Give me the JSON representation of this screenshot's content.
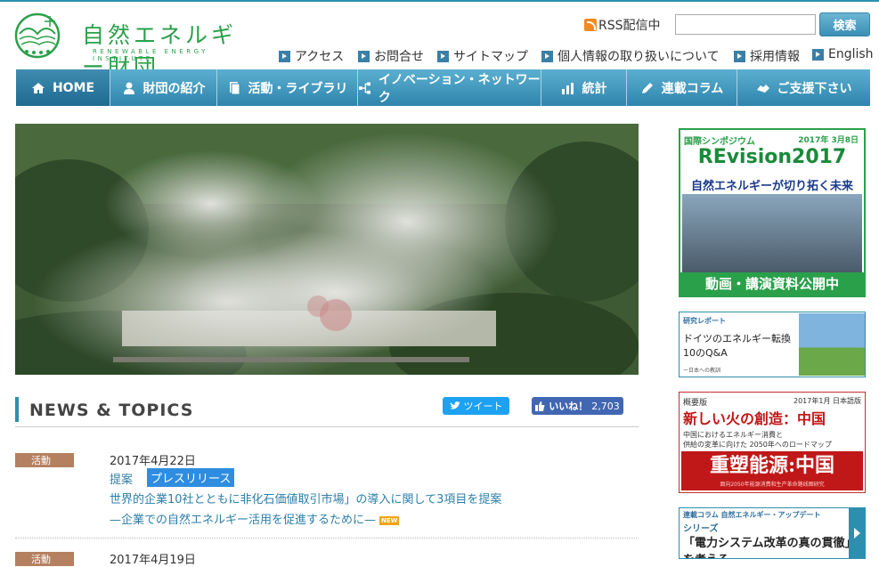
{
  "header": {
    "logo_jp": "自然エネルギー財団",
    "logo_en": "RENEWABLE ENERGY INSTITUTE",
    "rss_label": "RSS配信中",
    "search_placeholder": "",
    "search_button": "検索",
    "util_links": [
      "アクセス",
      "お問合せ",
      "サイトマップ",
      "個人情報の取り扱いについて",
      "採用情報",
      "English"
    ]
  },
  "nav": {
    "items": [
      {
        "label": "HOME",
        "icon": "home-icon"
      },
      {
        "label": "財団の紹介",
        "icon": "person-icon"
      },
      {
        "label": "活動・ライブラリ",
        "icon": "document-icon"
      },
      {
        "label": "イノベーション・ネットワーク",
        "icon": "network-icon"
      },
      {
        "label": "統計",
        "icon": "bar-chart-icon"
      },
      {
        "label": "連載コラム",
        "icon": "pen-icon"
      },
      {
        "label": "ご支援下さい",
        "icon": "handshake-icon"
      }
    ]
  },
  "news": {
    "title": "NEWS & TOPICS",
    "tweet_label": "ツイート",
    "fb_label": "いいね！",
    "fb_count": "2,703",
    "items": [
      {
        "tag": "活動",
        "date": "2017年4月22日",
        "category": "提案",
        "badge": "プレスリリース",
        "line1": "世界的企業10社とともに非化石価値取引市場」の導入に関して3項目を提案",
        "line2": "—企業での自然エネルギー活用を促進するために—",
        "new_label": "NEW"
      },
      {
        "tag": "活動",
        "date": "2017年4月19日"
      }
    ]
  },
  "sidebar": {
    "symposium": {
      "kicker": "国際シンポジウム",
      "date": "2017年 3月8日",
      "title": "REvision2017",
      "subtitle": "自然エネルギーが切り拓く未来",
      "cta": "動画・講演資料公開中"
    },
    "report": {
      "kicker": "研究レポート",
      "line1": "ドイツのエネルギー転換",
      "line2": "10のQ&A",
      "note": "ー日本への教訓"
    },
    "china": {
      "kicker": "概要版",
      "date": "2017年1月 日本語版",
      "title": "新しい火の創造：中国",
      "desc1": "中国におけるエネルギー消費と",
      "desc2": "供給の変革に向けた 2050年へのロードマップ",
      "title_cn": "重塑能源:中国",
      "sub_cn": "面向2050年能源消费和生产革命路线图研究"
    },
    "column": {
      "kicker": "連載コラム 自然エネルギー・アップデート",
      "series": "シリーズ",
      "title": "「電力システム改革の真の貫徹」を考える"
    }
  }
}
